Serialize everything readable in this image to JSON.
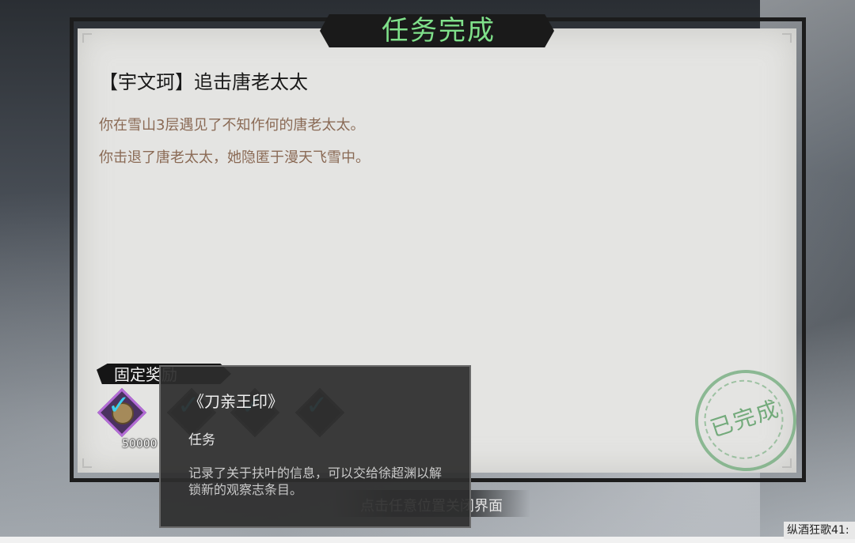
{
  "dialog": {
    "title": "任务完成",
    "quest_title": "【宇文珂】追击唐老太太",
    "description_lines": [
      "你在雪山3层遇见了不知作何的唐老太太。",
      "你击退了唐老太太，她隐匿于漫天飞雪中。"
    ],
    "stamp_text": "已完成",
    "close_hint": "点击任意位置关闭界面"
  },
  "rewards": {
    "label": "固定奖励",
    "items": [
      {
        "icon": "coin-icon",
        "count": "50000",
        "highlight_color": "#b36bd6"
      },
      {
        "icon": "seal-item-icon",
        "count": ""
      },
      {
        "icon": "item-icon",
        "count": ""
      },
      {
        "icon": "item-icon",
        "count": ""
      }
    ]
  },
  "tooltip": {
    "name": "《刀亲王印》",
    "type": "任务",
    "description": "记录了关于扶叶的信息，可以交给徐超渊以解锁新的观察志条目。"
  },
  "watermark": "纵酒狂歌41:",
  "colors": {
    "title_green": "#7fe08a",
    "description_brown": "#8a6a55",
    "check_cyan": "#3ccff0",
    "stamp_green": "#5fa069"
  }
}
